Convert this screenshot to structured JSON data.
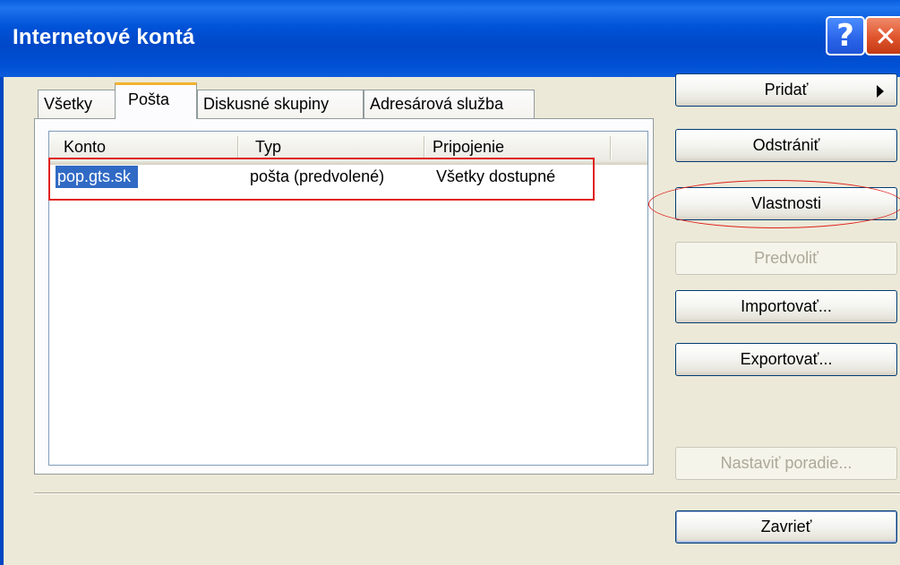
{
  "window": {
    "title": "Internetové kontá",
    "help_glyph": "?",
    "close_glyph": "✕"
  },
  "tabs": [
    {
      "label": "Všetky"
    },
    {
      "label": "Pošta"
    },
    {
      "label": "Diskusné skupiny"
    },
    {
      "label": "Adresárová služba"
    }
  ],
  "active_tab": "Pošta",
  "accounts_list": {
    "columns": [
      "Konto",
      "Typ",
      "Pripojenie"
    ],
    "rows": [
      {
        "konto": "pop.gts.sk",
        "typ": "pošta (predvolené)",
        "pripojenie": "Všetky dostupné",
        "selected": true
      }
    ]
  },
  "buttons": {
    "add": "Pridať",
    "remove": "Odstrániť",
    "properties": "Vlastnosti",
    "set_default": "Predvoliť",
    "import": "Importovať...",
    "export": "Exportovať...",
    "set_order": "Nastaviť poradie...",
    "close": "Zavrieť"
  },
  "colors": {
    "titlebar": "#0052d6",
    "selection": "#316ac5",
    "annotation_red": "#e0201a",
    "dialog_bg": "#ece9d8"
  },
  "icons": {
    "add_submenu": "triangle-right-icon"
  }
}
